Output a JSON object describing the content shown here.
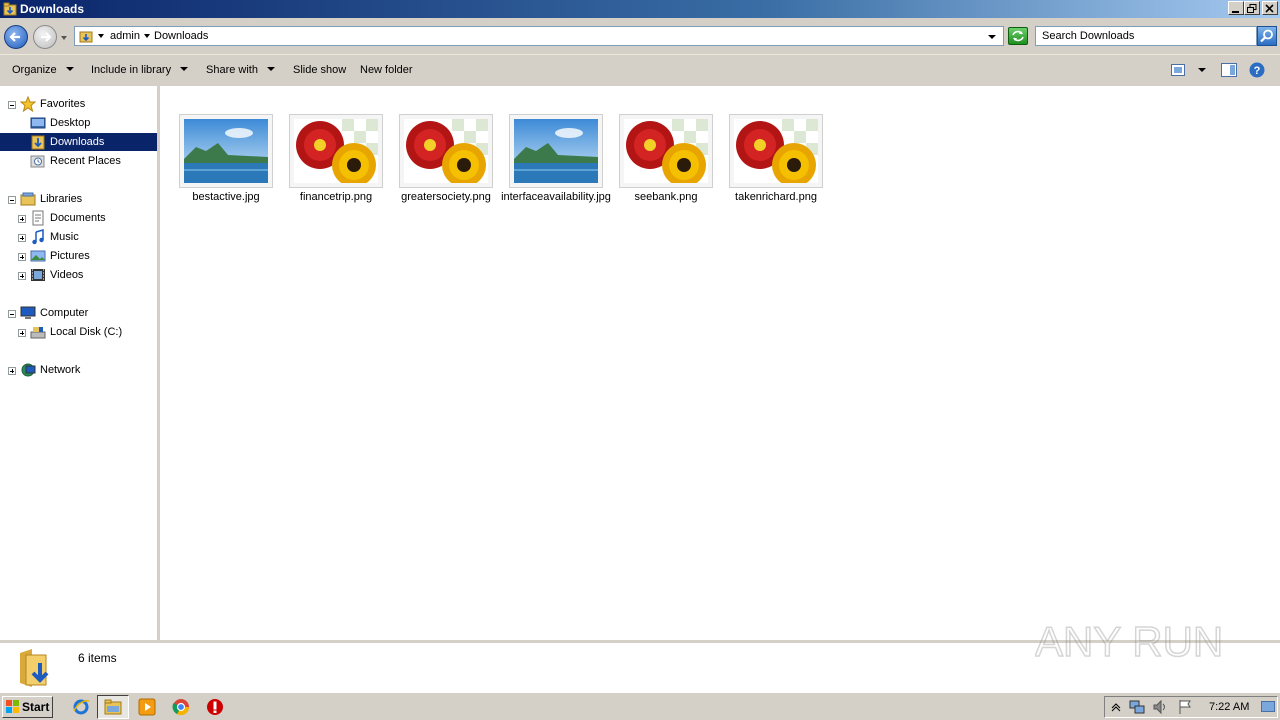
{
  "window": {
    "title": "Downloads"
  },
  "address": {
    "crumbs": [
      "admin",
      "Downloads"
    ],
    "search_placeholder": "Search Downloads"
  },
  "toolbar": {
    "organize": "Organize",
    "include_in_library": "Include in library",
    "share_with": "Share with",
    "slide_show": "Slide show",
    "new_folder": "New folder"
  },
  "nav": {
    "favorites": {
      "label": "Favorites",
      "items": [
        "Desktop",
        "Downloads",
        "Recent Places"
      ]
    },
    "libraries": {
      "label": "Libraries",
      "items": [
        "Documents",
        "Music",
        "Pictures",
        "Videos"
      ]
    },
    "computer": {
      "label": "Computer",
      "items": [
        "Local Disk (C:)"
      ]
    },
    "network": {
      "label": "Network"
    }
  },
  "files": [
    {
      "name": "bestactive.jpg",
      "thumb": "landscape"
    },
    {
      "name": "financetrip.png",
      "thumb": "flowers"
    },
    {
      "name": "greatersociety.png",
      "thumb": "flowers"
    },
    {
      "name": "interfaceavailability.jpg",
      "thumb": "landscape"
    },
    {
      "name": "seebank.png",
      "thumb": "flowers"
    },
    {
      "name": "takenrichard.png",
      "thumb": "flowers"
    }
  ],
  "details": {
    "count": "6 items"
  },
  "taskbar": {
    "start": "Start",
    "clock": "7:22 AM"
  },
  "watermark": "ANY RUN",
  "colors": {
    "selection": "#0a246a",
    "chrome": "#d4d0c8"
  }
}
